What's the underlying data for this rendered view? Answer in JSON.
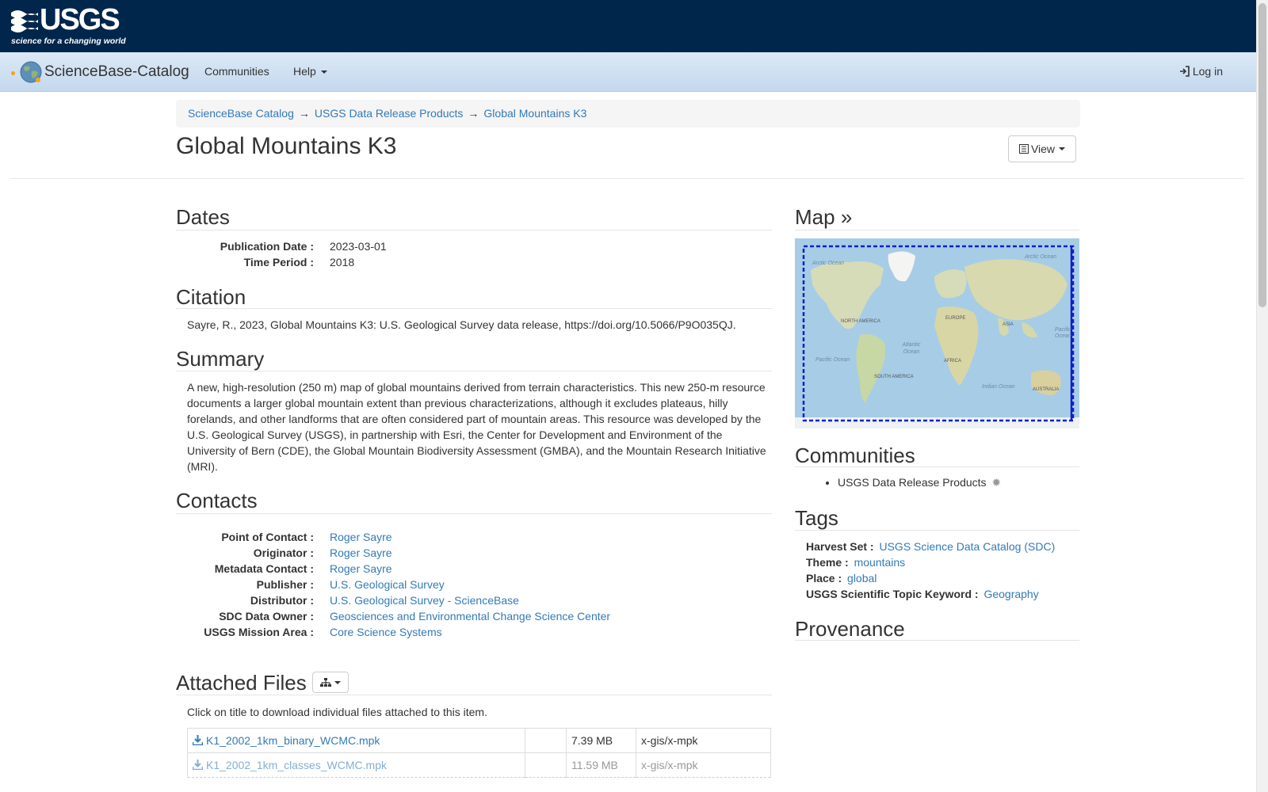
{
  "usgs": {
    "logo_word": "USGS",
    "tagline": "science for a changing world"
  },
  "nav": {
    "brand": "ScienceBase-Catalog",
    "communities": "Communities",
    "help": "Help",
    "login": "Log in"
  },
  "breadcrumb": [
    "ScienceBase Catalog",
    "USGS Data Release Products",
    "Global Mountains K3"
  ],
  "page_title": "Global Mountains K3",
  "view_button": "View",
  "dates": {
    "heading": "Dates",
    "rows": [
      {
        "label": "Publication Date :",
        "value": "2023-03-01"
      },
      {
        "label": "Time Period :",
        "value": "2018"
      }
    ]
  },
  "citation": {
    "heading": "Citation",
    "text": "Sayre, R., 2023, Global Mountains K3: U.S. Geological Survey data release, https://doi.org/10.5066/P9O035QJ."
  },
  "summary": {
    "heading": "Summary",
    "text": "A new, high-resolution (250 m) map of global mountains derived from terrain characteristics. This new 250-m resource documents a larger global mountain extent than previous characterizations, although it excludes plateaus, hilly forelands, and other landforms that are often considered part of mountain areas. This resource was developed by the U.S. Geological Survey (USGS), in partnership with Esri, the Center for Development and Environment of the University of Bern (CDE), the Global Mountain Biodiversity Assessment (GMBA), and the Mountain Research Initiative (MRI)."
  },
  "contacts": {
    "heading": "Contacts",
    "rows": [
      {
        "label": "Point of Contact :",
        "value": "Roger Sayre"
      },
      {
        "label": "Originator :",
        "value": "Roger Sayre"
      },
      {
        "label": "Metadata Contact :",
        "value": "Roger Sayre"
      },
      {
        "label": "Publisher :",
        "value": "U.S. Geological Survey"
      },
      {
        "label": "Distributor :",
        "value": "U.S. Geological Survey - ScienceBase"
      },
      {
        "label": "SDC Data Owner :",
        "value": "Geosciences and Environmental Change Science Center"
      },
      {
        "label": "USGS Mission Area :",
        "value": "Core Science Systems"
      }
    ]
  },
  "attached_files": {
    "heading": "Attached Files",
    "instructions": "Click on title to download individual files attached to this item.",
    "files": [
      {
        "name": "K1_2002_1km_binary_WCMC.mpk",
        "size": "7.39 MB",
        "type": "x-gis/x-mpk"
      },
      {
        "name": "K1_2002_1km_classes_WCMC.mpk",
        "size": "11.59 MB",
        "type": "x-gis/x-mpk"
      }
    ]
  },
  "map": {
    "heading": "Map",
    "labels": {
      "arctic_w": "Arctic Ocean",
      "arctic_e": "Arctic Ocean",
      "north_america": "NORTH AMERICA",
      "europe": "EUROPE",
      "asia": "ASIA",
      "pacific_w": "Pacific Ocean",
      "pacific_e": "Pacific Ocean",
      "atlantic": "Atlantic Ocean",
      "africa": "AFRICA",
      "south_america": "SOUTH AMERICA",
      "indian": "Indian Ocean",
      "australia": "AUSTRALIA"
    }
  },
  "communities": {
    "heading": "Communities",
    "items": [
      "USGS Data Release Products"
    ]
  },
  "tags": {
    "heading": "Tags",
    "rows": [
      {
        "label": "Harvest Set :",
        "value": "USGS Science Data Catalog (SDC)"
      },
      {
        "label": "Theme :",
        "value": "mountains"
      },
      {
        "label": "Place :",
        "value": "global"
      },
      {
        "label": "USGS Scientific Topic Keyword :",
        "value": "Geography"
      }
    ]
  },
  "provenance": {
    "heading": "Provenance"
  }
}
